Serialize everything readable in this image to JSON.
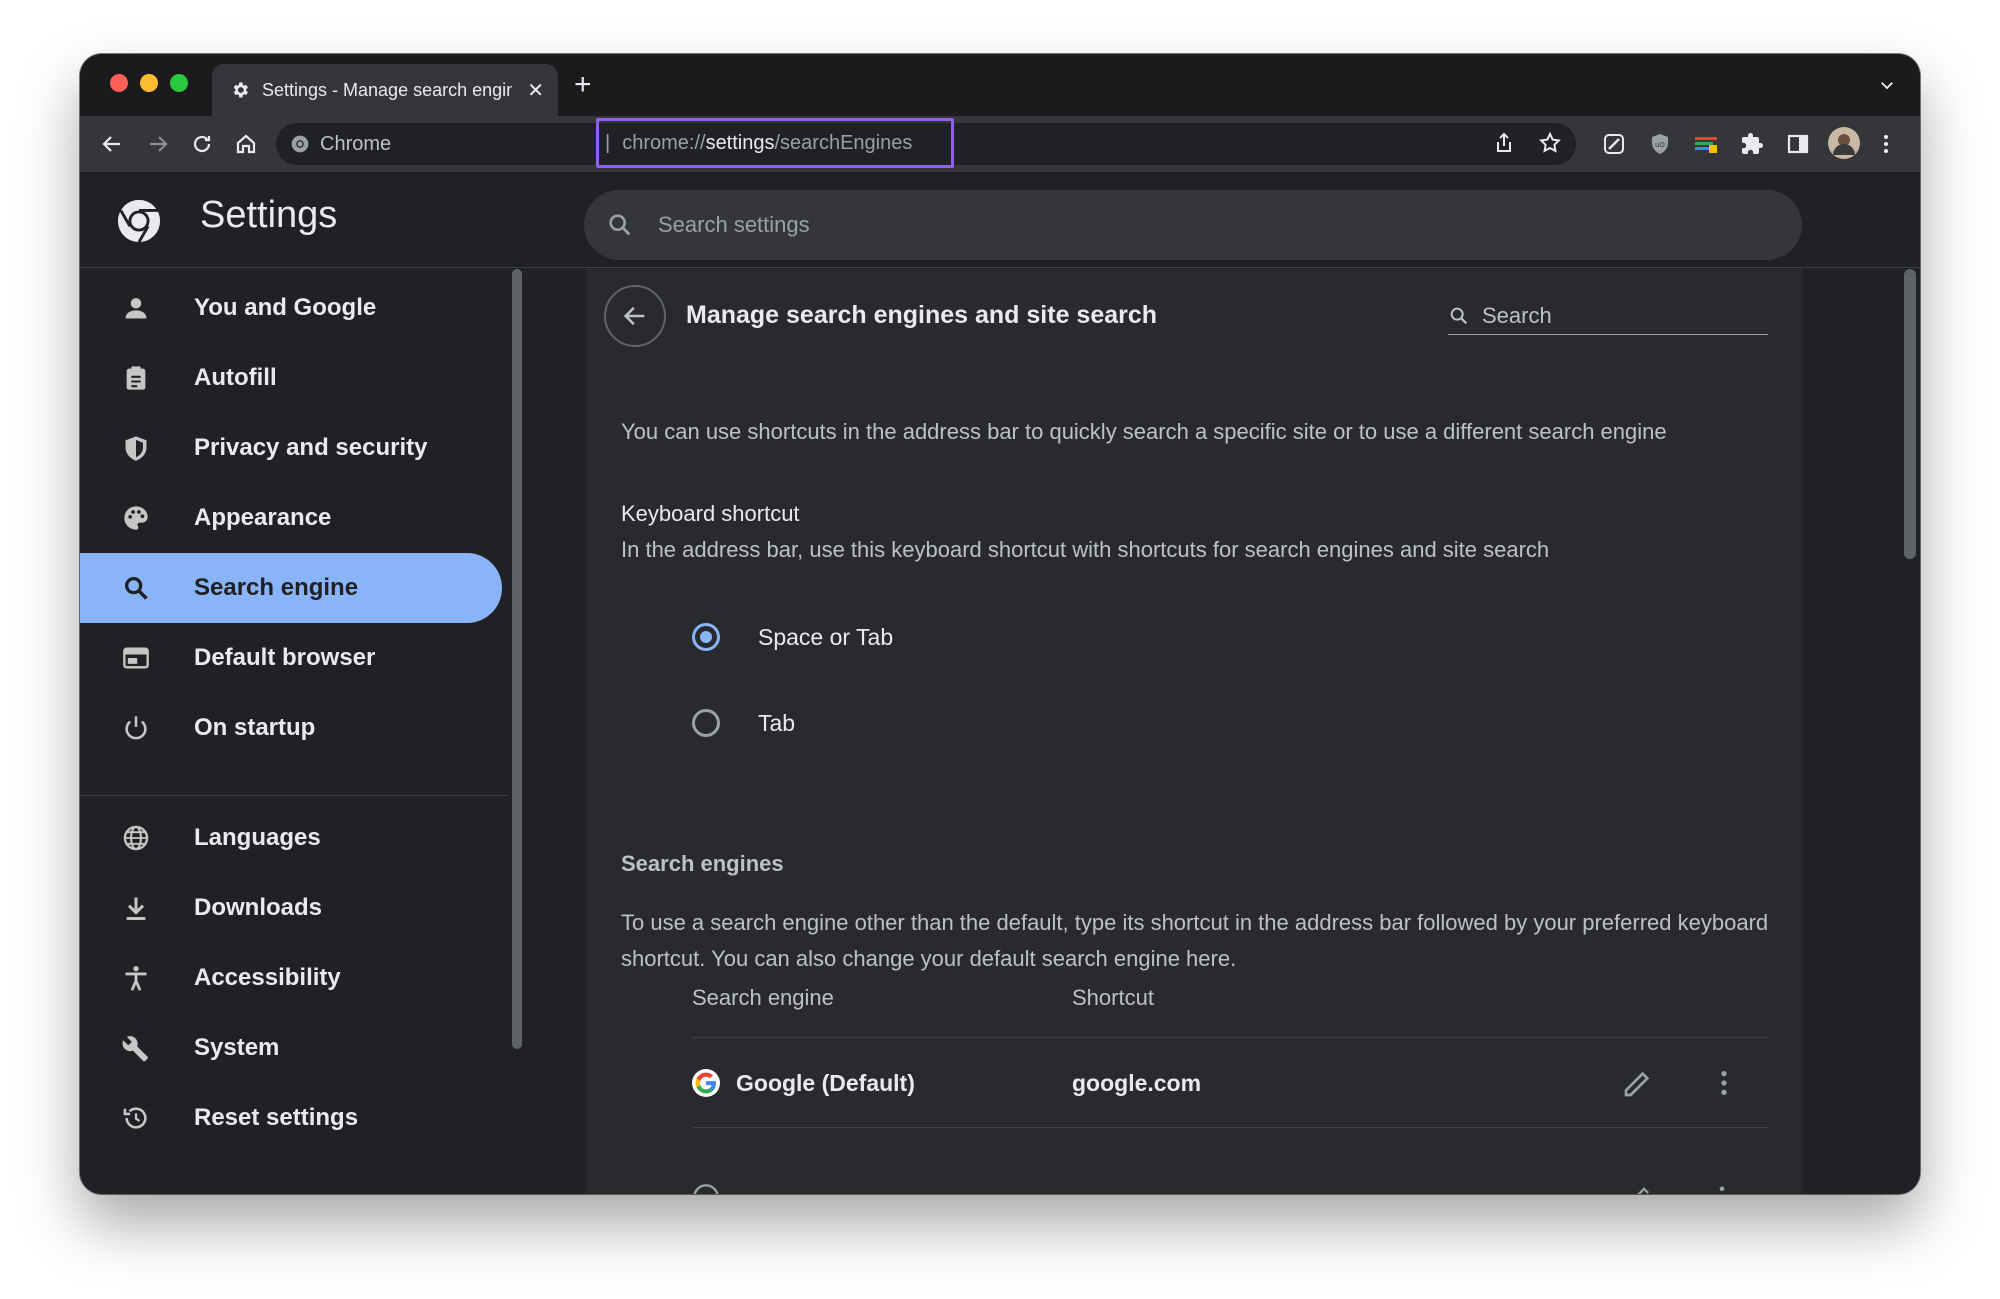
{
  "browser": {
    "tab_title": "Settings - Manage search engines and site search",
    "new_tab_symbol": "+",
    "tab_close_symbol": "✕",
    "site_chip": "Chrome",
    "url_scheme": "chrome://",
    "url_host": "settings",
    "url_path": "/searchEngines",
    "accent_outline": "#8f5ff0"
  },
  "settings": {
    "title": "Settings",
    "search_placeholder": "Search settings"
  },
  "sidebar": {
    "items": [
      {
        "label": "You and Google",
        "icon": "person-icon"
      },
      {
        "label": "Autofill",
        "icon": "clipboard-icon"
      },
      {
        "label": "Privacy and security",
        "icon": "shield-icon"
      },
      {
        "label": "Appearance",
        "icon": "palette-icon"
      },
      {
        "label": "Search engine",
        "icon": "search-icon",
        "active": true
      },
      {
        "label": "Default browser",
        "icon": "browser-icon"
      },
      {
        "label": "On startup",
        "icon": "power-icon"
      },
      {
        "label": "Languages",
        "icon": "globe-icon"
      },
      {
        "label": "Downloads",
        "icon": "download-icon"
      },
      {
        "label": "Accessibility",
        "icon": "accessibility-icon"
      },
      {
        "label": "System",
        "icon": "wrench-icon"
      },
      {
        "label": "Reset settings",
        "icon": "history-icon"
      }
    ],
    "active_color": "#8ab4f8"
  },
  "page": {
    "title": "Manage search engines and site search",
    "search_placeholder": "Search",
    "intro": "You can use shortcuts in the address bar to quickly search a specific site or to use a different search engine",
    "keyboard_shortcut": {
      "title": "Keyboard shortcut",
      "description": "In the address bar, use this keyboard shortcut with shortcuts for search engines and site search",
      "options": [
        {
          "label": "Space or Tab",
          "selected": true
        },
        {
          "label": "Tab",
          "selected": false
        }
      ]
    },
    "search_engines": {
      "title": "Search engines",
      "description": "To use a search engine other than the default, type its shortcut in the address bar followed by your preferred keyboard shortcut. You can also change your default search engine here.",
      "columns": [
        "Search engine",
        "Shortcut"
      ],
      "rows": [
        {
          "name": "Google (Default)",
          "shortcut": "google.com",
          "icon": "google-icon"
        }
      ]
    }
  }
}
